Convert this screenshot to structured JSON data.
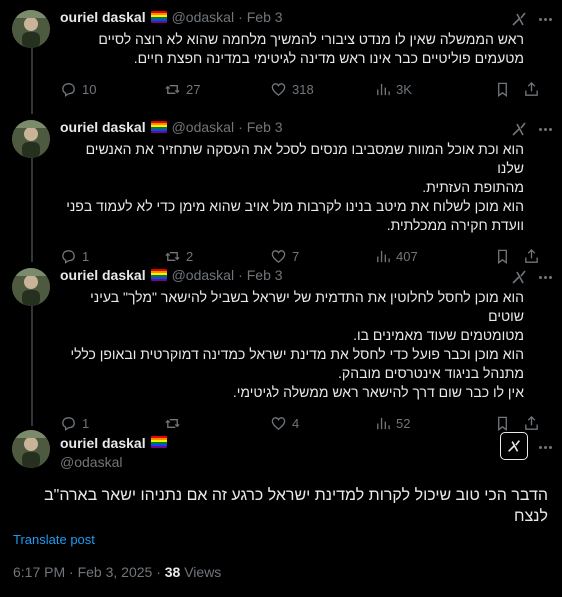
{
  "author": {
    "name": "ouriel daskal",
    "flag": "🏳️‍🌈",
    "handle": "@odaskal"
  },
  "replies": [
    {
      "date": "Feb 3",
      "text": [
        "ראש הממשלה שאין לו מנדט ציבורי להמשיך מלחמה שהוא לא רוצה לסיים",
        "מטעמים פוליטיים כבר אינו ראש מדינה לגיטימי במדינה חפצת חיים."
      ],
      "stats": {
        "replies": "10",
        "reposts": "27",
        "likes": "318",
        "views": "3K"
      }
    },
    {
      "date": "Feb 3",
      "text": [
        "הוא וכת אוכל המוות שמסביבו מנסים לסכל את העסקה שתחזיר את האנשים שלנו",
        "מהתופת העזתית.",
        "הוא מוכן לשלוח את מיטב בנינו לקרבות מול אויב שהוא מימן כדי לא לעמוד בפני",
        "וועדת חקירה ממכלתית."
      ],
      "stats": {
        "replies": "1",
        "reposts": "2",
        "likes": "7",
        "views": "407"
      }
    },
    {
      "date": "Feb 3",
      "text": [
        "הוא מוכן לחסל לחלוטין את התדמית של ישראל בשביל להישאר \"מלך\" בעיני שוטים",
        "מטומטמים שעוד מאמינים בו.",
        "הוא מוכן וכבר פועל כדי לחסל את מדינת ישראל כמדינה דמוקרטית ובאופן כללי",
        "מתנהל בניגוד אינטרסים מובהק.",
        "אין לו כבר שום דרך להישאר ראש ממשלה לגיטימי."
      ],
      "stats": {
        "replies": "1",
        "reposts": "",
        "likes": "4",
        "views": "52"
      }
    }
  ],
  "main": {
    "text": [
      "הדבר הכי טוב שיכול לקרות למדינת ישראל כרגע זה אם נתניהו ישאר בארה\"ב",
      "לנצח"
    ],
    "translate_label": "Translate post",
    "time": "6:17 PM · Feb 3, 2025 · ",
    "views_count": "38",
    "views_label": " Views"
  },
  "ui": {
    "dot": "·",
    "colors": {
      "background": "#000000",
      "text": "#e7e9ea",
      "muted": "#71767b",
      "link": "#1d9bf0",
      "divider": "#333639"
    },
    "icons": [
      "grok-icon",
      "more-icon",
      "reply-icon",
      "repost-icon",
      "like-icon",
      "views-icon",
      "bookmark-icon",
      "share-icon"
    ]
  }
}
